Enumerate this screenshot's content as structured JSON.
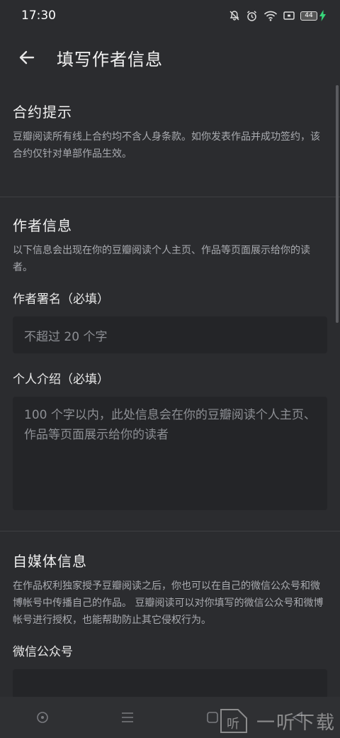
{
  "status": {
    "time": "17:30",
    "battery": "44"
  },
  "app_bar": {
    "title": "填写作者信息"
  },
  "contract": {
    "title": "合约提示",
    "desc": "豆瓣阅读所有线上合约均不含人身条款。如你发表作品并成功签约，该合约仅针对单部作品生效。"
  },
  "author": {
    "title": "作者信息",
    "desc": "以下信息会出现在你的豆瓣阅读个人主页、作品等页面展示给你的读者。",
    "name_label": "作者署名（必填）",
    "name_placeholder": "不超过 20 个字",
    "bio_label": "个人介绍（必填）",
    "bio_placeholder": "100 个字以内，此处信息会在你的豆瓣阅读个人主页、作品等页面展示给你的读者"
  },
  "media": {
    "title": "自媒体信息",
    "desc": "在作品权利独家授予豆瓣阅读之后，你也可以在自己的微信公众号和微博帐号中传播自己的作品。 豆瓣阅读可以对你填写的微信公众号和微博帐号进行授权，也能帮助防止其它侵权行为。",
    "wechat_label": "微信公众号"
  },
  "watermark": {
    "text": "一听下载",
    "logo_text": "听"
  },
  "icons": {
    "back": "arrow-left-icon",
    "bell_off": "bell-off-icon",
    "alarm": "alarm-icon",
    "wifi": "wifi-icon",
    "nav_circle": "nav-circle-icon",
    "nav_menu": "nav-menu-icon",
    "nav_square": "nav-square-icon"
  }
}
